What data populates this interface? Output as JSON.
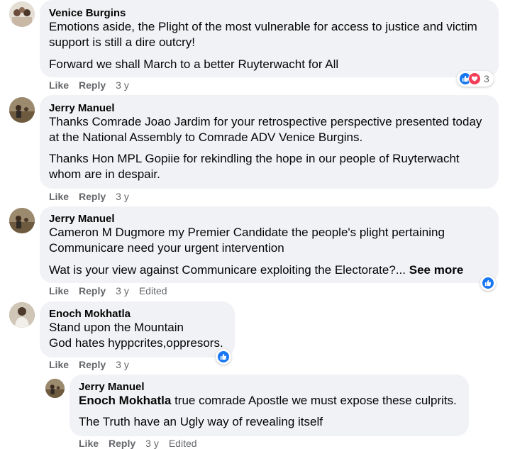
{
  "comments": [
    {
      "name": "Venice Burgins",
      "lines": [
        "Emotions aside, the Plight of the most vulnerable for access to justice and victim",
        "support is still a dire outcry!",
        "Forward we shall March to a better Ruyterwacht for All"
      ],
      "actions": {
        "like": "Like",
        "reply": "Reply",
        "time": "3 y"
      },
      "reaction_count": "3"
    },
    {
      "name": "Jerry Manuel",
      "lines": [
        "Thanks Comrade Joao Jardim for your retrospective perspective presented today",
        "at the National Assembly to Comrade ADV Venice Burgins.",
        "Thanks Hon MPL Gopiie for rekindling the hope in our people of Ruyterwacht",
        "whom are in despair."
      ],
      "actions": {
        "like": "Like",
        "reply": "Reply",
        "time": "3 y"
      }
    },
    {
      "name": "Jerry Manuel",
      "lines": [
        "Cameron M Dugmore my Premier Candidate the people's plight pertaining",
        "Communicare need your urgent intervention",
        "Wat is your view against Communicare exploiting the Electorate?..."
      ],
      "see_more": "See more",
      "actions": {
        "like": "Like",
        "reply": "Reply",
        "time": "3 y",
        "edited": "Edited"
      }
    },
    {
      "name": "Enoch Mokhatla",
      "lines": [
        "Stand upon the Mountain",
        "God hates hyppcrites,oppresors."
      ],
      "actions": {
        "like": "Like",
        "reply": "Reply",
        "time": "3 y"
      }
    },
    {
      "name": "Jerry Manuel",
      "mention": "Enoch Mokhatla",
      "lines": [
        " true comrade Apostle we must expose these culprits.",
        "The Truth have an Ugly way of revealing itself"
      ],
      "actions": {
        "like": "Like",
        "reply": "Reply",
        "time": "3 y",
        "edited": "Edited"
      }
    }
  ],
  "colors": {
    "bubble": "#f0f2f5",
    "meta_text": "#65676b",
    "like_blue": "#1877f2",
    "love_red": "#f33e58"
  },
  "icons": [
    "like-icon",
    "love-icon"
  ]
}
